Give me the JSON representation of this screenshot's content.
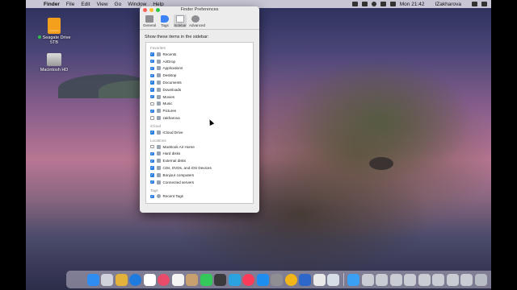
{
  "menubar": {
    "apple": "",
    "app": "Finder",
    "items": [
      "File",
      "Edit",
      "View",
      "Go",
      "Window",
      "Help"
    ],
    "clock": "Mon 21:42",
    "user": "IZakharova"
  },
  "desktop": {
    "icons": [
      {
        "label": "Seagate Drive 5TB",
        "icon": "external-drive-icon"
      },
      {
        "label": "Macintosh HD",
        "icon": "internal-drive-icon"
      }
    ]
  },
  "window": {
    "title": "Finder Preferences",
    "tabs": [
      {
        "label": "General",
        "icon": "general-icon",
        "color": "#8e8e93"
      },
      {
        "label": "Tags",
        "icon": "tags-icon",
        "color": "#3b82f6"
      },
      {
        "label": "Sidebar",
        "icon": "sidebar-icon",
        "color": "#9ca3af",
        "selected": true
      },
      {
        "label": "Advanced",
        "icon": "gear-icon",
        "color": "#8e8e93"
      }
    ],
    "heading": "Show these items in the sidebar:",
    "sections": {
      "favorites": {
        "title": "Favorites",
        "items": [
          {
            "label": "Recents",
            "checked": true
          },
          {
            "label": "AirDrop",
            "checked": true
          },
          {
            "label": "Applications",
            "checked": true
          },
          {
            "label": "Desktop",
            "checked": true
          },
          {
            "label": "Documents",
            "checked": true
          },
          {
            "label": "Downloads",
            "checked": true
          },
          {
            "label": "Movies",
            "checked": true
          },
          {
            "label": "Music",
            "checked": false
          },
          {
            "label": "Pictures",
            "checked": true
          },
          {
            "label": "zakharova",
            "checked": false
          }
        ]
      },
      "icloud": {
        "title": "iCloud",
        "items": [
          {
            "label": "iCloud Drive",
            "checked": true
          }
        ]
      },
      "locations": {
        "title": "Locations",
        "items": [
          {
            "label": "MacBook Air Home",
            "checked": false
          },
          {
            "label": "Hard disks",
            "checked": true
          },
          {
            "label": "External disks",
            "checked": true
          },
          {
            "label": "CDs, DVDs, and iOS Devices",
            "checked": true
          },
          {
            "label": "Bonjour computers",
            "checked": true
          },
          {
            "label": "Connected servers",
            "checked": true
          }
        ]
      },
      "tags": {
        "title": "Tags",
        "items": [
          {
            "label": "Recent Tags",
            "checked": true
          }
        ]
      }
    }
  },
  "colors": {
    "accent": "#2c7fe0",
    "close": "#ff5f57",
    "minimize": "#febc2e",
    "zoom": "#28c840"
  },
  "dock": [
    {
      "icon": "finder-icon",
      "color": "#2f8cf0"
    },
    {
      "icon": "launchpad-icon",
      "color": "#d0d3db"
    },
    {
      "icon": "notes-yellow-icon",
      "color": "#e2b23a"
    },
    {
      "icon": "safari-icon",
      "color": "#1e7be0"
    },
    {
      "icon": "calendar-icon",
      "color": "#ffffff"
    },
    {
      "icon": "photos-icon",
      "color": "#e84c6a"
    },
    {
      "icon": "reminders-icon",
      "color": "#f4f4f4"
    },
    {
      "icon": "contacts-icon",
      "color": "#c8a070"
    },
    {
      "icon": "messages-icon",
      "color": "#34c759"
    },
    {
      "icon": "facetime-icon",
      "color": "#3a3a3c"
    },
    {
      "icon": "telegram-icon",
      "color": "#2aa3e0"
    },
    {
      "icon": "music-icon",
      "color": "#fa3c5a"
    },
    {
      "icon": "app-store-icon",
      "color": "#1d8ef0"
    },
    {
      "icon": "settings-icon",
      "color": "#8e8e93"
    },
    {
      "icon": "chrome-icon",
      "color": "#f2b61b"
    },
    {
      "icon": "preview-icon",
      "color": "#2c67c9"
    },
    {
      "icon": "document-icon",
      "color": "#e9e9ea"
    },
    {
      "icon": "screenshot-icon",
      "color": "#d7dde6"
    },
    {
      "icon": "folder-icon",
      "color": "#3aa0f3"
    },
    {
      "icon": "window-icon",
      "color": "#c9ccd3"
    },
    {
      "icon": "window-icon-2",
      "color": "#c9ccd3"
    },
    {
      "icon": "window-icon-3",
      "color": "#c9ccd3"
    },
    {
      "icon": "window-icon-4",
      "color": "#c9ccd3"
    },
    {
      "icon": "window-icon-5",
      "color": "#c9ccd3"
    },
    {
      "icon": "window-icon-6",
      "color": "#c9ccd3"
    },
    {
      "icon": "window-icon-7",
      "color": "#c9ccd3"
    },
    {
      "icon": "window-icon-8",
      "color": "#c9ccd3"
    },
    {
      "icon": "trash-icon",
      "color": "#b8bcc4"
    }
  ]
}
